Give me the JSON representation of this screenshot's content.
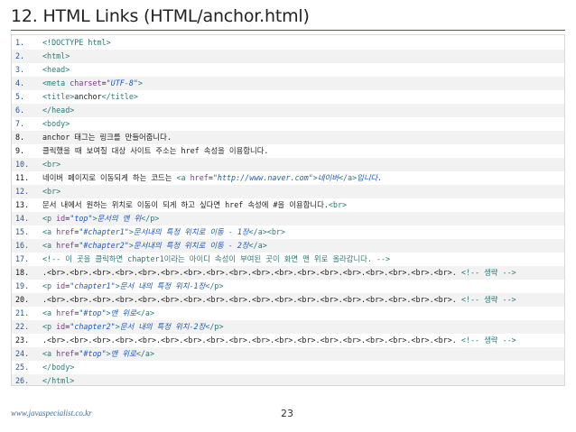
{
  "slide": {
    "title": "12. HTML Links (HTML/anchor.html)",
    "footer": "www.javaspecialist.co.kr",
    "page_number": "23"
  },
  "code_lines": [
    {
      "n": "1.",
      "dark": false,
      "parts": [
        [
          "tag",
          "<!DOCTYPE html>"
        ]
      ]
    },
    {
      "n": "2.",
      "dark": false,
      "parts": [
        [
          "tag",
          "<html>"
        ]
      ]
    },
    {
      "n": "3.",
      "dark": false,
      "parts": [
        [
          "tag",
          "<head>"
        ]
      ]
    },
    {
      "n": "4.",
      "dark": false,
      "parts": [
        [
          "tag",
          "<meta "
        ],
        [
          "attr",
          "charset"
        ],
        [
          "txt",
          "="
        ],
        [
          "str",
          "\"UTF-8\""
        ],
        [
          "tag",
          ">"
        ]
      ]
    },
    {
      "n": "5.",
      "dark": false,
      "parts": [
        [
          "tag",
          "<title>"
        ],
        [
          "txt",
          "anchor"
        ],
        [
          "tag",
          "</title>"
        ]
      ]
    },
    {
      "n": "6.",
      "dark": false,
      "parts": [
        [
          "tag",
          "</head>"
        ]
      ]
    },
    {
      "n": "7.",
      "dark": false,
      "parts": [
        [
          "tag",
          "<body>"
        ]
      ]
    },
    {
      "n": "8.",
      "dark": true,
      "parts": [
        [
          "txt",
          "anchor 태그는 링크를 만들어줍니다."
        ]
      ]
    },
    {
      "n": "9.",
      "dark": true,
      "parts": [
        [
          "txt",
          "클릭했을 때 보여질 대상 사이트 주소는 href 속성을 이용합니다."
        ]
      ]
    },
    {
      "n": "10.",
      "dark": false,
      "parts": [
        [
          "tag",
          "<br>"
        ]
      ]
    },
    {
      "n": "11.",
      "dark": true,
      "parts": [
        [
          "txt",
          "네이버 페이지로 이동되게 하는 코드는 "
        ],
        [
          "tag",
          "<a "
        ],
        [
          "attr",
          "href"
        ],
        [
          "txt",
          "="
        ],
        [
          "str",
          "\"http://www.naver.com\""
        ],
        [
          "tag",
          ">"
        ],
        [
          "kw",
          "네이버"
        ],
        [
          "tag",
          "</a>"
        ],
        [
          "kw",
          "입니다."
        ]
      ]
    },
    {
      "n": "12.",
      "dark": false,
      "parts": [
        [
          "tag",
          "<br>"
        ]
      ]
    },
    {
      "n": "13.",
      "dark": true,
      "parts": [
        [
          "txt",
          "문서 내에서 원하는 위치로 이동이 되게 하고 싶다면 href 속성에 #을 이용합니다."
        ],
        [
          "tag",
          "<br>"
        ]
      ]
    },
    {
      "n": "14.",
      "dark": false,
      "parts": [
        [
          "tag",
          "<p "
        ],
        [
          "attr",
          "id"
        ],
        [
          "txt",
          "="
        ],
        [
          "str",
          "\"top\""
        ],
        [
          "tag",
          ">"
        ],
        [
          "kw",
          "문서의 맨 위"
        ],
        [
          "tag",
          "</p>"
        ]
      ]
    },
    {
      "n": "15.",
      "dark": false,
      "parts": [
        [
          "tag",
          "<a "
        ],
        [
          "attr",
          "href"
        ],
        [
          "txt",
          "="
        ],
        [
          "str",
          "\"#chapter1\""
        ],
        [
          "tag",
          ">"
        ],
        [
          "kw",
          "문서내의 특정 위치로 이동 - 1장"
        ],
        [
          "tag",
          "</a><br>"
        ]
      ]
    },
    {
      "n": "16.",
      "dark": false,
      "parts": [
        [
          "tag",
          "<a "
        ],
        [
          "attr",
          "href"
        ],
        [
          "txt",
          "="
        ],
        [
          "str",
          "\"#chapter2\""
        ],
        [
          "tag",
          ">"
        ],
        [
          "kw",
          "문서내의 특정 위치로 이동 - 2장"
        ],
        [
          "tag",
          "</a>"
        ]
      ]
    },
    {
      "n": "17.",
      "dark": false,
      "parts": [
        [
          "cmt",
          "<!-- 이 곳을 클릭하면 chapter1이라는 아이디 속성이 부여된 곳이 화면 맨 위로 올라갑니다. -->"
        ]
      ]
    },
    {
      "n": "18.",
      "dark": true,
      "parts": [
        [
          "txt",
          ".<br>.<br>.<br>.<br>.<br>.<br>.<br>.<br>.<br>.<br>.<br>.<br>.<br>.<br>.<br>.<br>.<br>.<br>. "
        ],
        [
          "cmt",
          "<!-- 생략 -->"
        ]
      ]
    },
    {
      "n": "19.",
      "dark": false,
      "parts": [
        [
          "tag",
          "<p "
        ],
        [
          "attr",
          "id"
        ],
        [
          "txt",
          "="
        ],
        [
          "str",
          "\"chapter1\""
        ],
        [
          "tag",
          ">"
        ],
        [
          "kw",
          "문서 내의 특정 위치-1장"
        ],
        [
          "tag",
          "</p>"
        ]
      ]
    },
    {
      "n": "20.",
      "dark": true,
      "parts": [
        [
          "txt",
          ".<br>.<br>.<br>.<br>.<br>.<br>.<br>.<br>.<br>.<br>.<br>.<br>.<br>.<br>.<br>.<br>.<br>.<br>. "
        ],
        [
          "cmt",
          "<!-- 생략 -->"
        ]
      ]
    },
    {
      "n": "21.",
      "dark": false,
      "parts": [
        [
          "tag",
          "<a "
        ],
        [
          "attr",
          "href"
        ],
        [
          "txt",
          "="
        ],
        [
          "str",
          "\"#top\""
        ],
        [
          "tag",
          ">"
        ],
        [
          "kw",
          "맨 위로"
        ],
        [
          "tag",
          "</a>"
        ]
      ]
    },
    {
      "n": "22.",
      "dark": false,
      "parts": [
        [
          "tag",
          "<p "
        ],
        [
          "attr",
          "id"
        ],
        [
          "txt",
          "="
        ],
        [
          "str",
          "\"chapter2\""
        ],
        [
          "tag",
          ">"
        ],
        [
          "kw",
          "문서 내의 특정 위치-2장"
        ],
        [
          "tag",
          "</p>"
        ]
      ]
    },
    {
      "n": "23.",
      "dark": true,
      "parts": [
        [
          "txt",
          ".<br>.<br>.<br>.<br>.<br>.<br>.<br>.<br>.<br>.<br>.<br>.<br>.<br>.<br>.<br>.<br>.<br>.<br>. "
        ],
        [
          "cmt",
          "<!-- 생략 -->"
        ]
      ]
    },
    {
      "n": "24.",
      "dark": false,
      "parts": [
        [
          "tag",
          "<a "
        ],
        [
          "attr",
          "href"
        ],
        [
          "txt",
          "="
        ],
        [
          "str",
          "\"#top\""
        ],
        [
          "tag",
          ">"
        ],
        [
          "kw",
          "맨 위로"
        ],
        [
          "tag",
          "</a>"
        ]
      ]
    },
    {
      "n": "25.",
      "dark": false,
      "parts": [
        [
          "tag",
          "</body>"
        ]
      ]
    },
    {
      "n": "26.",
      "dark": false,
      "parts": [
        [
          "tag",
          "</html>"
        ]
      ]
    }
  ]
}
